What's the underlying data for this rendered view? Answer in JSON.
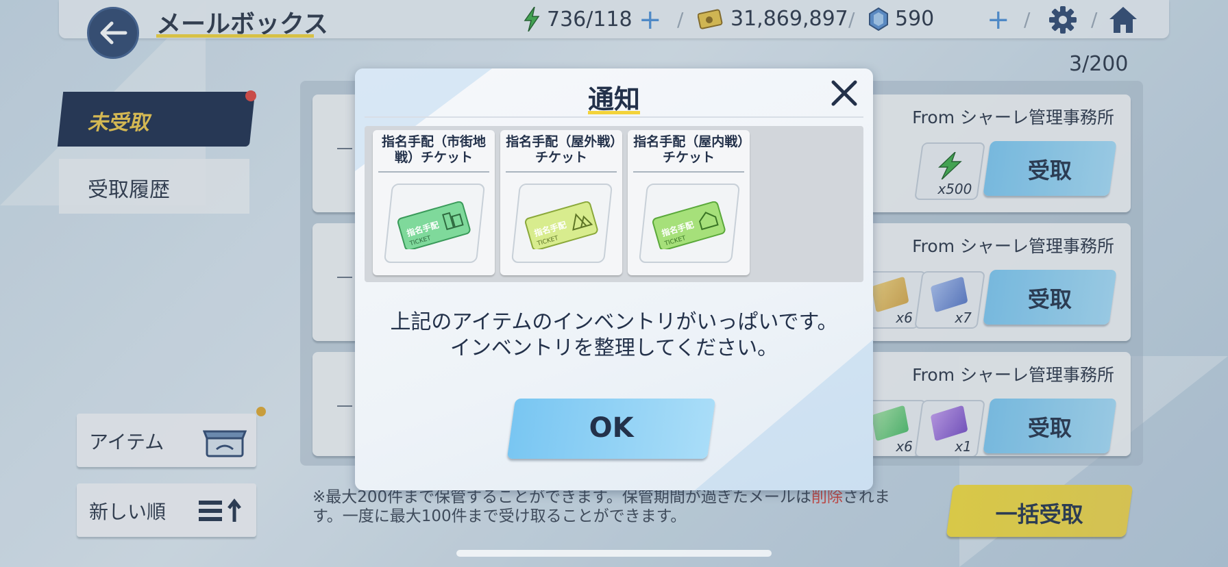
{
  "header": {
    "title": "メールボックス",
    "ap": "736/118",
    "credits": "31,869,897",
    "pyroxene": "590",
    "icons": [
      "back-arrow-icon",
      "ap-bolt-icon",
      "credit-icon",
      "pyroxene-icon",
      "plus-icon",
      "gear-icon",
      "home-icon"
    ]
  },
  "counter": "3/200",
  "tabs": {
    "unclaimed": "未受取",
    "history": "受取履歴"
  },
  "mails": [
    {
      "from": "From シャーレ管理事務所",
      "claim": "受取",
      "items": [
        {
          "qty": "x500",
          "icon": "ap-bolt-icon"
        }
      ]
    },
    {
      "from": "From シャーレ管理事務所",
      "claim": "受取",
      "items": [
        {
          "qty": "x6",
          "icon": "gold-ticket-icon"
        },
        {
          "qty": "x7",
          "icon": "blue-ticket-icon"
        }
      ]
    },
    {
      "from": "From シャーレ管理事務所",
      "claim": "受取",
      "items": [
        {
          "qty": "x6",
          "icon": "green-ticket-icon"
        },
        {
          "qty": "x1",
          "icon": "purple-ticket-icon"
        }
      ]
    }
  ],
  "side": {
    "item_filter": "アイテム",
    "sort": "新しい順"
  },
  "notice": {
    "part1": "※最大200件まで保管することができます。保管期間が過ぎたメールは",
    "red": "削除",
    "part2": "されます。一度に最大100件まで受け取ることができます。"
  },
  "bulk_claim": "一括受取",
  "modal": {
    "title": "通知",
    "items": [
      {
        "name": "指名手配（市街地戦）チケット",
        "icon": "city-ticket-icon"
      },
      {
        "name": "指名手配（屋外戦）チケット",
        "icon": "outdoor-ticket-icon"
      },
      {
        "name": "指名手配（屋内戦）チケット",
        "icon": "indoor-ticket-icon"
      }
    ],
    "message_line1": "上記のアイテムのインベントリがいっぱいです。",
    "message_line2": "インベントリを整理してください。",
    "ok": "OK",
    "ticket_text": "指名手配",
    "ticket_sub": "TICKET"
  },
  "colors": {
    "accent_yellow": "#f3d33a",
    "nav_dark": "#1d2d4c",
    "button_blue": "#7ec9f2",
    "notice_red": "#d2403a"
  }
}
